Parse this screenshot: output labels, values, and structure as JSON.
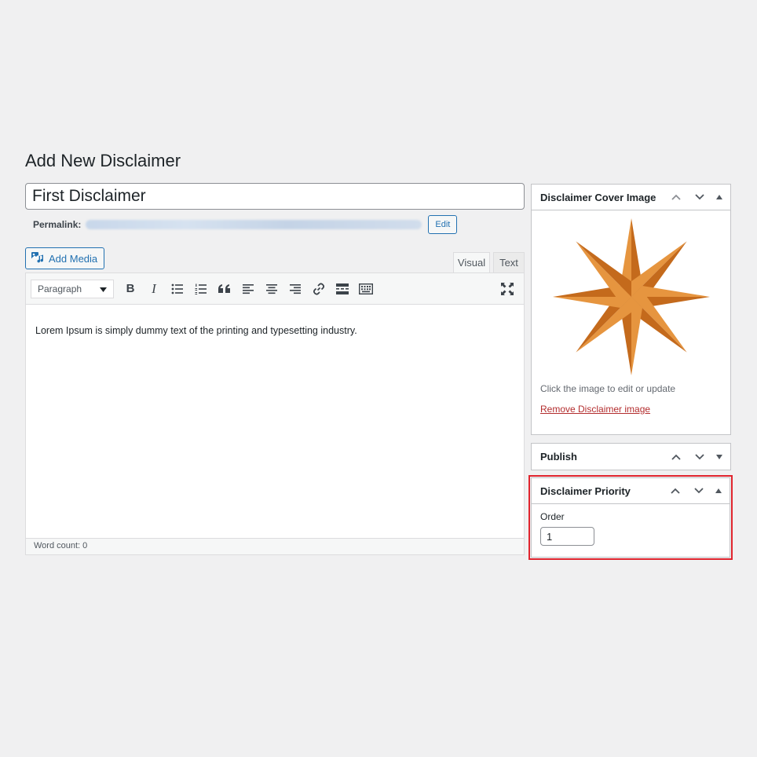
{
  "page": {
    "title": "Add New Disclaimer"
  },
  "post": {
    "title_value": "First Disclaimer",
    "permalink_label": "Permalink:",
    "edit_button": "Edit"
  },
  "editor": {
    "add_media": "Add Media",
    "tabs": {
      "visual": "Visual",
      "text": "Text"
    },
    "format_select": "Paragraph",
    "toolbar": {
      "bold": "B",
      "italic": "I"
    },
    "content": "Lorem Ipsum is simply dummy text of the printing and typesetting industry.",
    "word_count": "Word count: 0"
  },
  "sidebar": {
    "cover_image": {
      "title": "Disclaimer Cover Image",
      "hint": "Click the image to edit or update",
      "remove_link": "Remove Disclaimer image"
    },
    "publish": {
      "title": "Publish"
    },
    "priority": {
      "title": "Disclaimer Priority",
      "order_label": "Order",
      "order_value": "1"
    }
  },
  "colors": {
    "accent": "#2271b1",
    "highlight_outline": "#e0242e",
    "remove_link": "#b32d2e",
    "star_light": "#e6953f",
    "star_dark": "#c46a1c"
  },
  "icons": [
    "media-icon",
    "dropdown-arrow-icon",
    "bold-icon",
    "italic-icon",
    "bulleted-list-icon",
    "numbered-list-icon",
    "blockquote-icon",
    "align-left-icon",
    "align-center-icon",
    "align-right-icon",
    "link-icon",
    "read-more-icon",
    "toolbar-toggle-icon",
    "fullscreen-icon",
    "chevron-up-icon",
    "chevron-down-icon",
    "triangle-toggle-icon"
  ]
}
